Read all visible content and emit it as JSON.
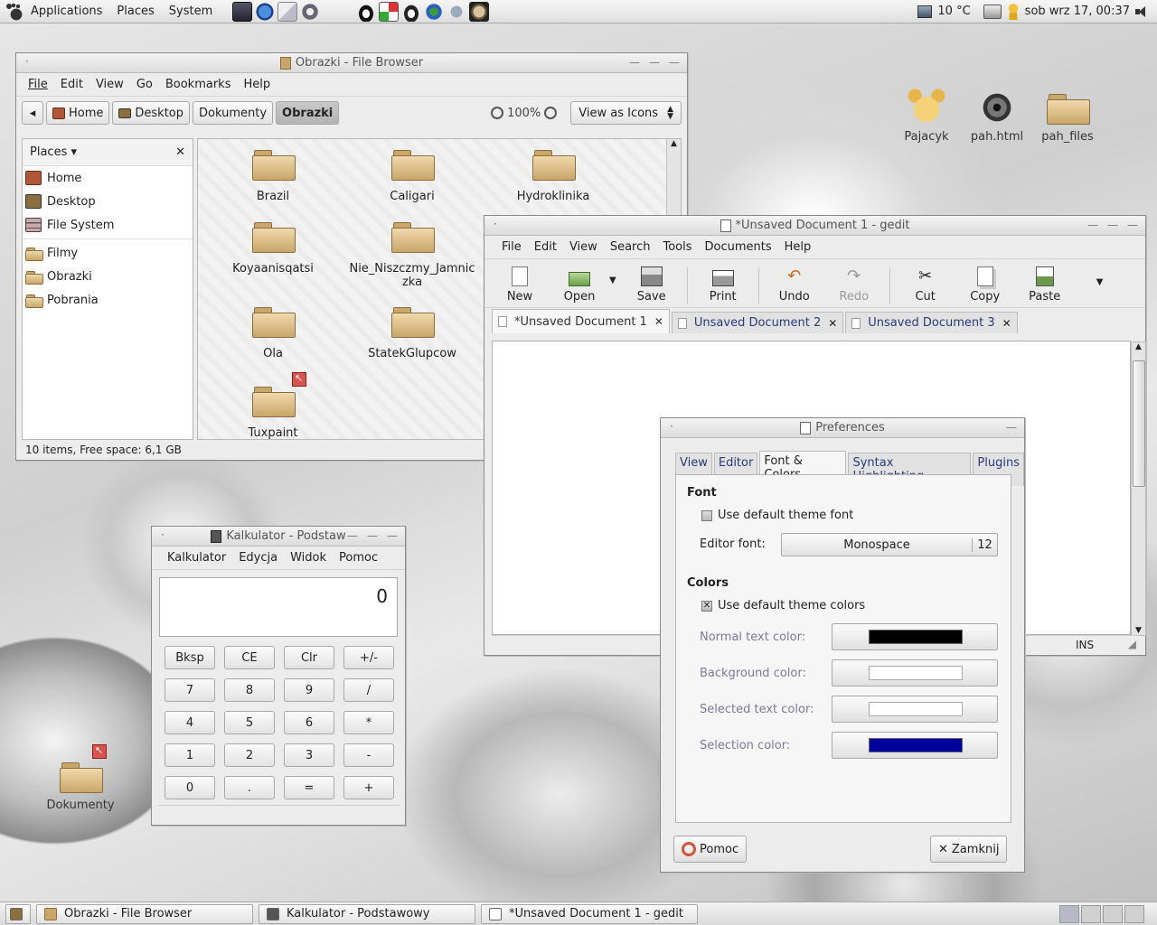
{
  "top_panel": {
    "menus": [
      "Applications",
      "Places",
      "System"
    ],
    "weather": "10 °C",
    "clock": "sob wrz 17, 00:37"
  },
  "file_browser": {
    "title": "Obrazki - File Browser",
    "menu": [
      "File",
      "Edit",
      "View",
      "Go",
      "Bookmarks",
      "Help"
    ],
    "path": [
      "Home",
      "Desktop",
      "Dokumenty",
      "Obrazki"
    ],
    "zoom": "100%",
    "view_mode": "View as Icons",
    "places_title": "Places",
    "places": [
      "Home",
      "Desktop",
      "File System"
    ],
    "bookmarks": [
      "Filmy",
      "Obrazki",
      "Pobrania"
    ],
    "items": [
      "Brazil",
      "Caligari",
      "Hydroklinika",
      "Koyaanisqatsi",
      "Nie_Niszczmy_Jamnic\nzka",
      "Ola",
      "StatekGlupcow",
      "Tuxpaint"
    ],
    "status": "10 items, Free space: 6,1 GB"
  },
  "gedit": {
    "title": "*Unsaved Document 1 - gedit",
    "menu": [
      "File",
      "Edit",
      "View",
      "Search",
      "Tools",
      "Documents",
      "Help"
    ],
    "toolbar": [
      "New",
      "Open",
      "Save",
      "Print",
      "Undo",
      "Redo",
      "Cut",
      "Copy",
      "Paste"
    ],
    "tabs": [
      "*Unsaved Document 1",
      "Unsaved Document 2",
      "Unsaved Document 3"
    ],
    "status_mode": "INS"
  },
  "preferences": {
    "title": "Preferences",
    "tabs": [
      "View",
      "Editor",
      "Font & Colors",
      "Syntax Highlighting",
      "Plugins"
    ],
    "font_section": "Font",
    "use_default_font": "Use default theme font",
    "editor_font_label": "Editor font:",
    "font_name": "Monospace",
    "font_size": "12",
    "colors_section": "Colors",
    "use_default_colors": "Use default theme colors",
    "color_labels": [
      "Normal text color:",
      "Background color:",
      "Selected text color:",
      "Selection color:"
    ],
    "color_values": [
      "#000000",
      "#ffffff",
      "#ffffff",
      "#00009c"
    ],
    "help_button": "Pomoc",
    "close_button": "Zamknij"
  },
  "calculator": {
    "title": "Kalkulator - Podstaw",
    "menu": [
      "Kalkulator",
      "Edycja",
      "Widok",
      "Pomoc"
    ],
    "display": "0",
    "buttons": [
      "Bksp",
      "CE",
      "Clr",
      "+/-",
      "7",
      "8",
      "9",
      "/",
      "4",
      "5",
      "6",
      "*",
      "1",
      "2",
      "3",
      "-",
      "0",
      ".",
      "=",
      "+"
    ]
  },
  "desktop_icons": [
    "Pajacyk",
    "pah.html",
    "pah_files",
    "Dokumenty"
  ],
  "taskbar": [
    "Obrazki - File Browser",
    "Kalkulator - Podstawowy",
    "*Unsaved Document 1 - gedit"
  ],
  "colors": {
    "folder": "#c9a66a",
    "selection": "#00009c",
    "link_tab": "#2a3a7a"
  }
}
